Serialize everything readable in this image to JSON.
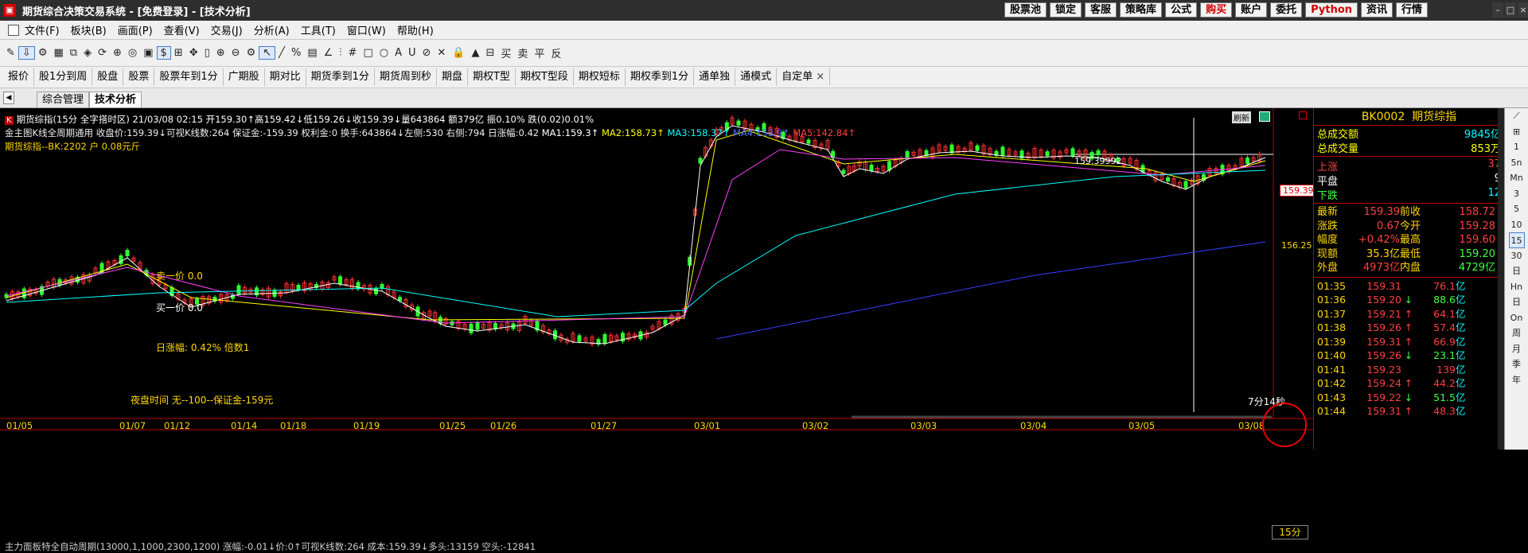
{
  "window": {
    "title": "期货综合决策交易系统 - [免费登录] - [技术分析]"
  },
  "title_buttons": [
    {
      "label": "股票池",
      "red": false
    },
    {
      "label": "锁定",
      "red": false
    },
    {
      "label": "客服",
      "red": false
    },
    {
      "label": "策略库",
      "red": false
    },
    {
      "label": "公式",
      "red": false
    },
    {
      "label": "购买",
      "red": true
    },
    {
      "label": "账户",
      "red": false
    },
    {
      "label": "委托",
      "red": false
    },
    {
      "label": "Python",
      "red": true
    },
    {
      "label": "资讯",
      "red": false
    },
    {
      "label": "行情",
      "red": false
    }
  ],
  "menu": [
    "文件(F)",
    "板块(B)",
    "画面(P)",
    "查看(V)",
    "交易(J)",
    "分析(A)",
    "工具(T)",
    "窗口(W)",
    "帮助(H)"
  ],
  "toolbar": [
    "✎",
    "⇩",
    "⚙",
    "▦",
    "⧉",
    "◈",
    "⟳",
    "⊕",
    "◎",
    "▣",
    "$",
    "⊞",
    "✥",
    "▯",
    "⊕",
    "⊖",
    "⚙",
    "↖",
    "╱",
    "%",
    "▤",
    "∠",
    "⫶",
    "#",
    "□",
    "○",
    "A",
    "U",
    "⊘",
    "✕",
    "🔒",
    "▲",
    "⊟",
    "买",
    "卖",
    "平",
    "反"
  ],
  "nav_tabs": [
    "报价",
    "股1分到周",
    "股盘",
    "股票",
    "股票年到1分",
    "广期股",
    "期对比",
    "期货季到1分",
    "期货周到秒",
    "期盘",
    "期权T型",
    "期权T型段",
    "期权短标",
    "期权季到1分",
    "通单独",
    "通模式",
    "自定单"
  ],
  "window_tabs": {
    "inactive": "综合管理",
    "active": "技术分析"
  },
  "chart_header": {
    "badge": "K",
    "line1": "期货综指(15分 全字搭时区) 21/03/08 02:15 开159.30↑高159.42↓低159.26↓收159.39↓量643864 额379亿 振0.10% 跌(0.02)0.01%",
    "line2": "金主图K线全周期通用 收盘价:159.39↓可视K线数:264 保证金:-159.39 权利金:0 换手:643864↓左侧:530 右侧:794 日涨幅:0.42",
    "ma1": "MA1:159.3↑",
    "ma2": "MA2:158.73↑",
    "ma3": "MA3:158.37↑",
    "ma4": "MA4:153.9↑",
    "ma5": "MA5:142.84↑",
    "line3": "期货综指--BK:2202 户 0.08元斤",
    "refresh": "刷新"
  },
  "annotations": {
    "sell": "卖一价 0.0",
    "buy": "买一价 0.0",
    "daily": "日涨幅: 0.42% 倍数1",
    "night": "夜盘时间 无--100--保证金-159元",
    "price_tag": "159.39",
    "price_label_mid": "156.25",
    "crosshair_value": "159.39992",
    "timer": "7分14秒"
  },
  "x_axis": [
    "01/05",
    "01/07",
    "01/12",
    "01/14",
    "01/18",
    "01/19",
    "01/25",
    "01/26",
    "01/27",
    "03/01",
    "03/02",
    "03/03",
    "03/04",
    "03/05",
    "03/08"
  ],
  "period": "15分",
  "lower_indicator": "主力面板特全自动周期(13000,1,1000,2300,1200) 涨幅:-0.01↓价:0↑可视K线数:264 成本:159.39↓多头:13159 空头:-12841",
  "quote_panel": {
    "code": "BK0002",
    "name": "期货综指",
    "total_amount_label": "总成交额",
    "total_amount": "9845亿",
    "total_volume_label": "总成交量",
    "total_volume": "853万",
    "up_label": "上涨",
    "up": "37",
    "flat_label": "平盘",
    "flat": "9",
    "down_label": "下跌",
    "down": "12",
    "grid": [
      [
        "最新",
        "159.39",
        "前收",
        "158.72"
      ],
      [
        "涨跌",
        "0.67",
        "今开",
        "159.28"
      ],
      [
        "幅度",
        "+0.42%",
        "最高",
        "159.60"
      ],
      [
        "现额",
        "35.3亿",
        "最低",
        "159.20"
      ],
      [
        "外盘",
        "4973亿",
        "内盘",
        "4729亿"
      ]
    ],
    "ticks": [
      {
        "time": "01:35",
        "price": "159.31",
        "dir": "",
        "amount": "76.1",
        "unit": "亿"
      },
      {
        "time": "01:36",
        "price": "159.20",
        "dir": "↓",
        "amount": "88.6",
        "unit": "亿"
      },
      {
        "time": "01:37",
        "price": "159.21",
        "dir": "↑",
        "amount": "64.1",
        "unit": "亿"
      },
      {
        "time": "01:38",
        "price": "159.26",
        "dir": "↑",
        "amount": "57.4",
        "unit": "亿"
      },
      {
        "time": "01:39",
        "price": "159.31",
        "dir": "↑",
        "amount": "66.9",
        "unit": "亿"
      },
      {
        "time": "01:40",
        "price": "159.26",
        "dir": "↓",
        "amount": "23.1",
        "unit": "亿"
      },
      {
        "time": "01:41",
        "price": "159.23",
        "dir": "",
        "amount": "139",
        "unit": "亿"
      },
      {
        "time": "01:42",
        "price": "159.24",
        "dir": "↑",
        "amount": "44.2",
        "unit": "亿"
      },
      {
        "time": "01:43",
        "price": "159.22",
        "dir": "↓",
        "amount": "51.5",
        "unit": "亿"
      },
      {
        "time": "01:44",
        "price": "159.31",
        "dir": "↑",
        "amount": "48.3",
        "unit": "亿"
      }
    ]
  },
  "sidebar": [
    "⟋",
    "⊞",
    "1",
    "5n",
    "Mn",
    "3",
    "5",
    "10",
    "15",
    "30",
    "日",
    "Hn",
    "日",
    "On",
    "周",
    "月",
    "季",
    "年"
  ],
  "sidebar_selected_index": 8,
  "colors": {
    "up": "#ff3030",
    "down": "#30ff30",
    "ma1": "#ffffff",
    "ma2": "#ffff00",
    "ma3": "#ff40ff",
    "ma4": "#00ffff",
    "ma5": "#3040ff"
  }
}
